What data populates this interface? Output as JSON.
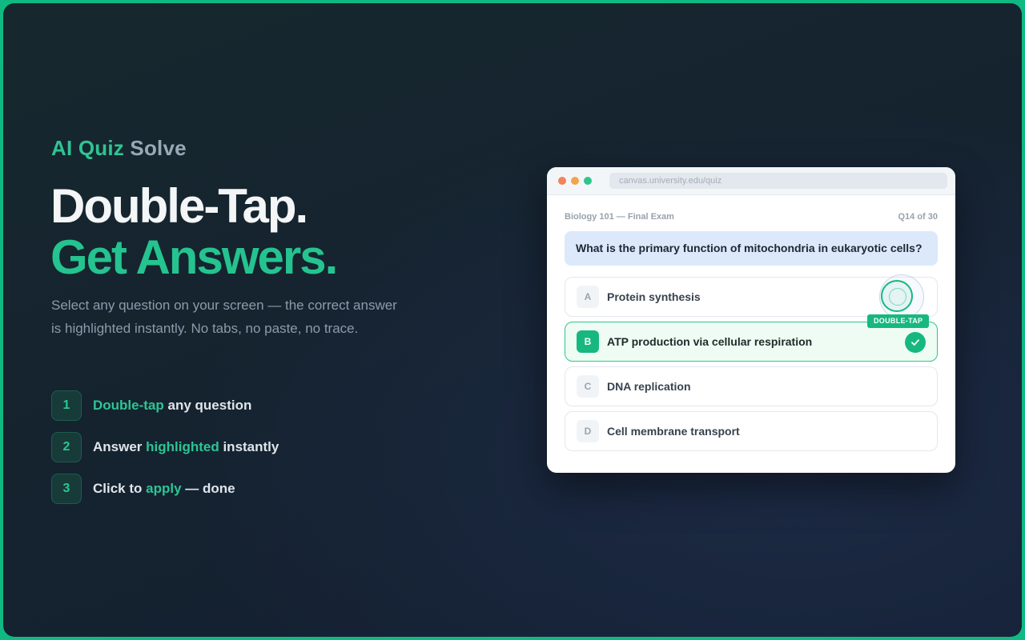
{
  "brand": {
    "part1": "AI",
    "part2": "Quiz",
    "part3": "Solve"
  },
  "headline": {
    "line1": "Double-Tap.",
    "line2": "Get Answers."
  },
  "subtext": "Select any question on your screen — the correct answer is highlighted instantly. No tabs, no paste, no trace.",
  "steps": [
    {
      "num": "1",
      "pre": "",
      "highlight": "Double-tap",
      "post": " any question"
    },
    {
      "num": "2",
      "pre": "Answer ",
      "highlight": "highlighted",
      "post": " instantly"
    },
    {
      "num": "3",
      "pre": "Click to ",
      "highlight": "apply",
      "post": " — done"
    }
  ],
  "browser": {
    "url": "canvas.university.edu/quiz",
    "course": "Biology 101 — Final Exam",
    "progress": "Q14 of 30",
    "question": "What is the primary function of mitochondria in eukaryotic cells?",
    "tap_label": "DOUBLE-TAP",
    "options": [
      {
        "letter": "A",
        "text": "Protein synthesis",
        "correct": false
      },
      {
        "letter": "B",
        "text": "ATP production via cellular respiration",
        "correct": true
      },
      {
        "letter": "C",
        "text": "DNA replication",
        "correct": false
      },
      {
        "letter": "D",
        "text": "Cell membrane transport",
        "correct": false
      }
    ]
  },
  "colors": {
    "accent": "#2ec493",
    "frame_border": "#10b981",
    "correct": "#17b87f",
    "question_bg": "#dce9fb"
  },
  "icons": {
    "correct_mark": "check-icon"
  }
}
